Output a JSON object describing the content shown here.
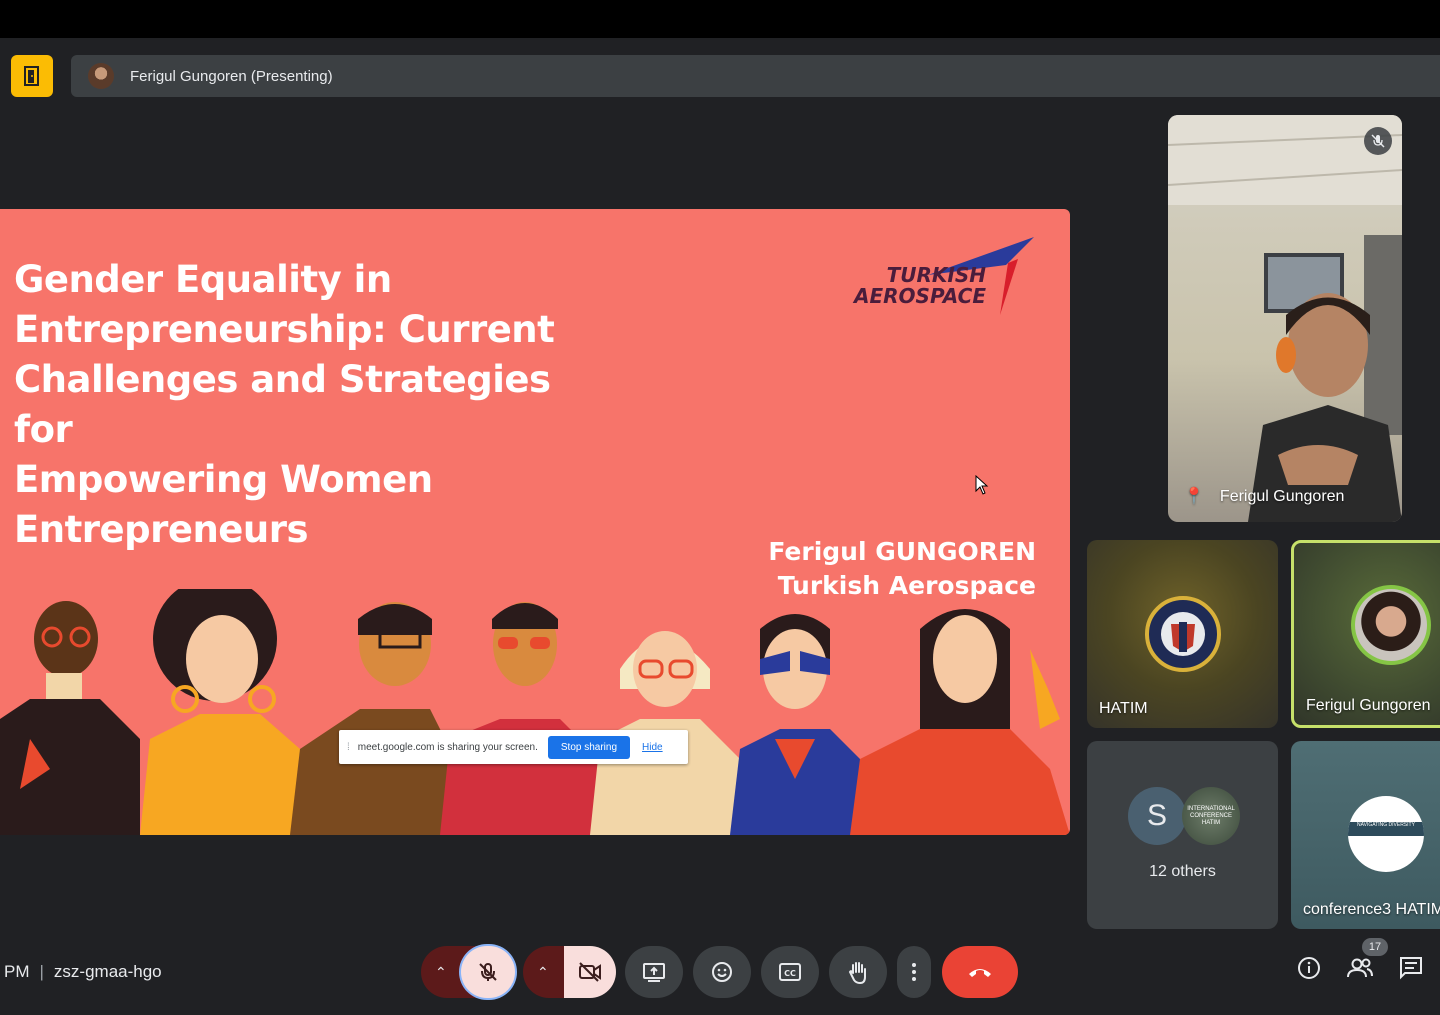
{
  "header": {
    "presenter_label": "Ferigul Gungoren (Presenting)"
  },
  "slide": {
    "title_lines": [
      "Gender Equality in",
      "Entrepreneurship: Current",
      "Challenges and Strategies for",
      "Empowering Women",
      "Entrepreneurs"
    ],
    "author_name": "Ferigul GUNGOREN",
    "author_org": "Turkish Aerospace",
    "logo_line1": "TURKISH",
    "logo_line2": "AEROSPACE"
  },
  "share_notice": {
    "text": "meet.google.com is sharing your screen.",
    "stop_label": "Stop sharing",
    "hide_label": "Hide"
  },
  "participants": {
    "main": {
      "name": "Ferigul Gungoren"
    },
    "hatim": {
      "name": "HATIM"
    },
    "ferigul": {
      "name": "Ferigul Gungoren"
    },
    "others": {
      "initial": "S",
      "avatar_text": "INTERNATIONAL CONFERENCE HATIM",
      "label": "12 others"
    },
    "conference": {
      "name": "conference3 HATIM",
      "avatar_text": "NAVIGATING DIVERSITY"
    }
  },
  "footer": {
    "time_fragment": "PM",
    "meeting_code": "zsz-gmaa-hgo",
    "participant_count": "17"
  },
  "colors": {
    "slide_bg": "#f7746a",
    "accent_yellow": "#fbbc04",
    "end_call": "#ea4335",
    "active_speaker": "#c6e06a"
  }
}
